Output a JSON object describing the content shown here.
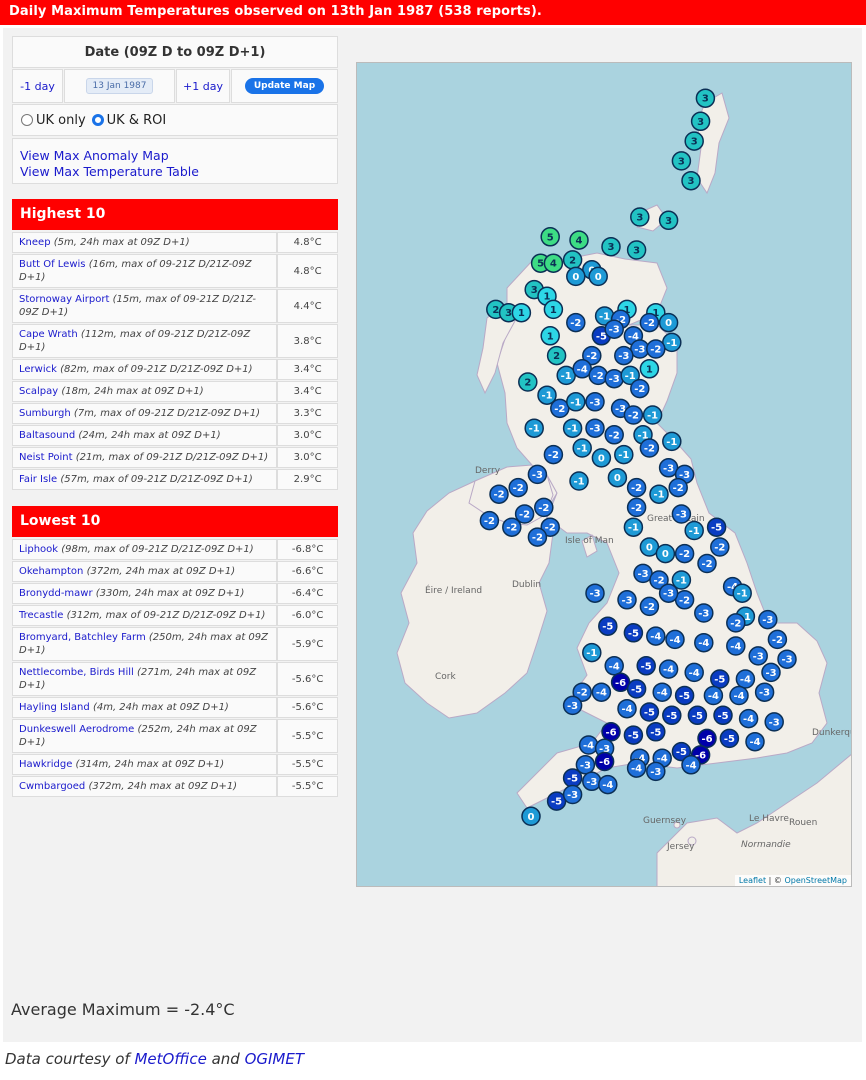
{
  "banner": "Daily Maximum Temperatures observed on 13th Jan 1987 (538 reports).",
  "date_panel": {
    "heading": "Date (09Z D to 09Z D+1)",
    "prev_label": "-1 day",
    "date_value": "13 Jan 1987",
    "next_label": "+1 day",
    "update_label": "Update Map"
  },
  "region": {
    "uk_label": "UK only",
    "ukroi_label": "UK & ROI",
    "selected": "UK & ROI"
  },
  "links": {
    "anomaly": "View Max Anomaly Map",
    "table": "View Max Temperature Table"
  },
  "highest": {
    "title": "Highest 10",
    "rows": [
      {
        "name": "Kneep",
        "desc": "(5m, 24h max at 09Z D+1)",
        "value": "4.8°C"
      },
      {
        "name": "Butt Of Lewis",
        "desc": "(16m, max of 09-21Z D/21Z-09Z D+1)",
        "value": "4.8°C"
      },
      {
        "name": "Stornoway Airport",
        "desc": "(15m, max of 09-21Z D/21Z-09Z D+1)",
        "value": "4.4°C"
      },
      {
        "name": "Cape Wrath",
        "desc": "(112m, max of 09-21Z D/21Z-09Z D+1)",
        "value": "3.8°C"
      },
      {
        "name": "Lerwick",
        "desc": "(82m, max of 09-21Z D/21Z-09Z D+1)",
        "value": "3.4°C"
      },
      {
        "name": "Scalpay",
        "desc": "(18m, 24h max at 09Z D+1)",
        "value": "3.4°C"
      },
      {
        "name": "Sumburgh",
        "desc": "(7m, max of 09-21Z D/21Z-09Z D+1)",
        "value": "3.3°C"
      },
      {
        "name": "Baltasound",
        "desc": "(24m, 24h max at 09Z D+1)",
        "value": "3.0°C"
      },
      {
        "name": "Neist Point",
        "desc": "(21m, max of 09-21Z D/21Z-09Z D+1)",
        "value": "3.0°C"
      },
      {
        "name": "Fair Isle",
        "desc": "(57m, max of 09-21Z D/21Z-09Z D+1)",
        "value": "2.9°C"
      }
    ]
  },
  "lowest": {
    "title": "Lowest 10",
    "rows": [
      {
        "name": "Liphook",
        "desc": "(98m, max of 09-21Z D/21Z-09Z D+1)",
        "value": "-6.8°C"
      },
      {
        "name": "Okehampton",
        "desc": "(372m, 24h max at 09Z D+1)",
        "value": "-6.6°C"
      },
      {
        "name": "Bronydd-mawr",
        "desc": "(330m, 24h max at 09Z D+1)",
        "value": "-6.4°C"
      },
      {
        "name": "Trecastle",
        "desc": "(312m, max of 09-21Z D/21Z-09Z D+1)",
        "value": "-6.0°C"
      },
      {
        "name": "Bromyard, Batchley Farm",
        "desc": "(250m, 24h max at 09Z D+1)",
        "value": "-5.9°C"
      },
      {
        "name": "Nettlecombe, Birds Hill",
        "desc": "(271m, 24h max at 09Z D+1)",
        "value": "-5.6°C"
      },
      {
        "name": "Hayling Island",
        "desc": "(4m, 24h max at 09Z D+1)",
        "value": "-5.6°C"
      },
      {
        "name": "Dunkeswell Aerodrome",
        "desc": "(252m, 24h max at 09Z D+1)",
        "value": "-5.5°C"
      },
      {
        "name": "Hawkridge",
        "desc": "(314m, 24h max at 09Z D+1)",
        "value": "-5.5°C"
      },
      {
        "name": "Cwmbargoed",
        "desc": "(372m, 24h max at 09Z D+1)",
        "value": "-5.5°C"
      }
    ]
  },
  "average": "Average Maximum = -2.4°C",
  "map": {
    "labels": {
      "ireland": "Éire / Ireland",
      "dublin": "Dublin",
      "cork": "Cork",
      "isle_of_man": "Isle of Man",
      "great_britain": "Great Britain",
      "guernsey": "Guernsey",
      "jersey": "Jersey",
      "le_havre": "Le Havre",
      "rouen": "Rouen",
      "normandie": "Normandie",
      "derry": "Derry",
      "dunkerque": "Dunkerque"
    },
    "attribution": {
      "leaflet": "Leaflet",
      "sep": " | © ",
      "osm": "OpenStreetMap"
    },
    "colors": {
      "warm4": "#3ddc84",
      "warm3": "#22c3c3",
      "mild1": "#2dd6e6",
      "zero": "#1e9ad6",
      "cold2": "#1f6fd9",
      "cold5": "#0a3cc2",
      "cold6": "#0000aa"
    },
    "markers": [
      {
        "v": 3,
        "lon": -0.85,
        "lat": 60.8
      },
      {
        "v": 3,
        "lon": -1.0,
        "lat": 60.45
      },
      {
        "v": 3,
        "lon": -1.2,
        "lat": 60.15
      },
      {
        "v": 3,
        "lon": -1.6,
        "lat": 59.85
      },
      {
        "v": 3,
        "lon": -1.3,
        "lat": 59.55
      },
      {
        "v": 3,
        "lon": -2.9,
        "lat": 59.0
      },
      {
        "v": 3,
        "lon": -2.0,
        "lat": 58.95
      },
      {
        "v": 5,
        "lon": -5.7,
        "lat": 58.7
      },
      {
        "v": 4,
        "lon": -4.8,
        "lat": 58.65
      },
      {
        "v": 3,
        "lon": -3.8,
        "lat": 58.55
      },
      {
        "v": 3,
        "lon": -3.0,
        "lat": 58.5
      },
      {
        "v": 5,
        "lon": -6.0,
        "lat": 58.3
      },
      {
        "v": 4,
        "lon": -5.6,
        "lat": 58.3
      },
      {
        "v": 2,
        "lon": -5.0,
        "lat": 58.35
      },
      {
        "v": 0,
        "lon": -4.4,
        "lat": 58.2
      },
      {
        "v": 0,
        "lon": -4.9,
        "lat": 58.1
      },
      {
        "v": 0,
        "lon": -4.2,
        "lat": 58.1
      },
      {
        "v": 3,
        "lon": -6.2,
        "lat": 57.9
      },
      {
        "v": 2,
        "lon": -7.4,
        "lat": 57.6
      },
      {
        "v": 3,
        "lon": -7.0,
        "lat": 57.55
      },
      {
        "v": 1,
        "lon": -6.6,
        "lat": 57.55
      },
      {
        "v": 1,
        "lon": -5.8,
        "lat": 57.8
      },
      {
        "v": 1,
        "lon": -5.6,
        "lat": 57.6
      },
      {
        "v": 1,
        "lon": -5.7,
        "lat": 57.2
      },
      {
        "v": 2,
        "lon": -5.5,
        "lat": 56.9
      },
      {
        "v": 2,
        "lon": -6.4,
        "lat": 56.5
      },
      {
        "v": 1,
        "lon": -3.3,
        "lat": 57.6
      },
      {
        "v": 1,
        "lon": -2.4,
        "lat": 57.55
      },
      {
        "v": 0,
        "lon": -2.0,
        "lat": 57.4
      },
      {
        "v": -2,
        "lon": -2.6,
        "lat": 57.4
      },
      {
        "v": -1,
        "lon": -1.9,
        "lat": 57.1
      },
      {
        "v": -2,
        "lon": -4.9,
        "lat": 57.4
      },
      {
        "v": -1,
        "lon": -4.0,
        "lat": 57.5
      },
      {
        "v": -2,
        "lon": -3.5,
        "lat": 57.45
      },
      {
        "v": -5,
        "lon": -4.1,
        "lat": 57.2
      },
      {
        "v": -3,
        "lon": -3.7,
        "lat": 57.3
      },
      {
        "v": -4,
        "lon": -3.1,
        "lat": 57.2
      },
      {
        "v": -3,
        "lon": -2.9,
        "lat": 57.0
      },
      {
        "v": -2,
        "lon": -2.4,
        "lat": 57.0
      },
      {
        "v": -3,
        "lon": -3.4,
        "lat": 56.9
      },
      {
        "v": -2,
        "lon": -4.4,
        "lat": 56.9
      },
      {
        "v": -1,
        "lon": -5.2,
        "lat": 56.6
      },
      {
        "v": -1,
        "lon": -5.8,
        "lat": 56.3
      },
      {
        "v": -4,
        "lon": -4.7,
        "lat": 56.7
      },
      {
        "v": -2,
        "lon": -4.2,
        "lat": 56.6
      },
      {
        "v": -3,
        "lon": -3.7,
        "lat": 56.55
      },
      {
        "v": -1,
        "lon": -3.2,
        "lat": 56.6
      },
      {
        "v": 1,
        "lon": -2.6,
        "lat": 56.7
      },
      {
        "v": -2,
        "lon": -2.9,
        "lat": 56.4
      },
      {
        "v": -2,
        "lon": -5.4,
        "lat": 56.1
      },
      {
        "v": -1,
        "lon": -4.9,
        "lat": 56.2
      },
      {
        "v": -3,
        "lon": -4.3,
        "lat": 56.2
      },
      {
        "v": -3,
        "lon": -3.5,
        "lat": 56.1
      },
      {
        "v": -2,
        "lon": -3.1,
        "lat": 56.0
      },
      {
        "v": -1,
        "lon": -2.5,
        "lat": 56.0
      },
      {
        "v": -1,
        "lon": -6.2,
        "lat": 55.8
      },
      {
        "v": -1,
        "lon": -5.0,
        "lat": 55.8
      },
      {
        "v": -3,
        "lon": -4.3,
        "lat": 55.8
      },
      {
        "v": -2,
        "lon": -3.7,
        "lat": 55.7
      },
      {
        "v": -1,
        "lon": -2.8,
        "lat": 55.7
      },
      {
        "v": -2,
        "lon": -5.6,
        "lat": 55.4
      },
      {
        "v": -1,
        "lon": -4.7,
        "lat": 55.5
      },
      {
        "v": 0,
        "lon": -4.1,
        "lat": 55.35
      },
      {
        "v": -1,
        "lon": -3.4,
        "lat": 55.4
      },
      {
        "v": -2,
        "lon": -2.6,
        "lat": 55.5
      },
      {
        "v": -1,
        "lon": -1.9,
        "lat": 55.6
      },
      {
        "v": -3,
        "lon": -2.0,
        "lat": 55.2
      },
      {
        "v": -3,
        "lon": -1.5,
        "lat": 55.1
      },
      {
        "v": -2,
        "lon": -1.7,
        "lat": 54.9
      },
      {
        "v": -1,
        "lon": -4.8,
        "lat": 55.0
      },
      {
        "v": 0,
        "lon": -3.6,
        "lat": 55.05
      },
      {
        "v": -2,
        "lon": -3.0,
        "lat": 54.9
      },
      {
        "v": -1,
        "lon": -2.3,
        "lat": 54.8
      },
      {
        "v": -3,
        "lon": -6.1,
        "lat": 55.1
      },
      {
        "v": -2,
        "lon": -6.7,
        "lat": 54.9
      },
      {
        "v": -2,
        "lon": -7.3,
        "lat": 54.8
      },
      {
        "v": -2,
        "lon": -5.9,
        "lat": 54.6
      },
      {
        "v": -2,
        "lon": -6.5,
        "lat": 54.5
      },
      {
        "v": -2,
        "lon": -7.6,
        "lat": 54.4
      },
      {
        "v": -2,
        "lon": -5.7,
        "lat": 54.3
      },
      {
        "v": -2,
        "lon": -6.9,
        "lat": 54.3
      },
      {
        "v": -2,
        "lon": -6.1,
        "lat": 54.15
      },
      {
        "v": -2,
        "lon": -3.0,
        "lat": 54.6
      },
      {
        "v": -1,
        "lon": -3.1,
        "lat": 54.3
      },
      {
        "v": -3,
        "lon": -1.6,
        "lat": 54.5
      },
      {
        "v": -1,
        "lon": -1.2,
        "lat": 54.25
      },
      {
        "v": -5,
        "lon": -0.5,
        "lat": 54.3
      },
      {
        "v": -2,
        "lon": -0.4,
        "lat": 54.0
      },
      {
        "v": 0,
        "lon": -2.6,
        "lat": 54.0
      },
      {
        "v": 0,
        "lon": -2.1,
        "lat": 53.9
      },
      {
        "v": -2,
        "lon": -1.5,
        "lat": 53.9
      },
      {
        "v": -2,
        "lon": -0.8,
        "lat": 53.75
      },
      {
        "v": -3,
        "lon": -2.8,
        "lat": 53.6
      },
      {
        "v": -2,
        "lon": -2.3,
        "lat": 53.5
      },
      {
        "v": -1,
        "lon": -1.6,
        "lat": 53.5
      },
      {
        "v": -4,
        "lon": 0.0,
        "lat": 53.4
      },
      {
        "v": -1,
        "lon": 0.3,
        "lat": 53.3
      },
      {
        "v": -3,
        "lon": -4.3,
        "lat": 53.3
      },
      {
        "v": -3,
        "lon": -3.3,
        "lat": 53.2
      },
      {
        "v": -2,
        "lon": -2.6,
        "lat": 53.1
      },
      {
        "v": -2,
        "lon": -1.5,
        "lat": 53.2
      },
      {
        "v": -3,
        "lon": -0.9,
        "lat": 53.0
      },
      {
        "v": -1,
        "lon": 0.4,
        "lat": 52.95
      },
      {
        "v": -3,
        "lon": 1.1,
        "lat": 52.9
      },
      {
        "v": -2,
        "lon": 1.4,
        "lat": 52.6
      },
      {
        "v": -5,
        "lon": -3.9,
        "lat": 52.8
      },
      {
        "v": -5,
        "lon": -3.1,
        "lat": 52.7
      },
      {
        "v": -4,
        "lon": -2.4,
        "lat": 52.65
      },
      {
        "v": -4,
        "lon": -1.8,
        "lat": 52.6
      },
      {
        "v": -4,
        "lon": -0.9,
        "lat": 52.55
      },
      {
        "v": -4,
        "lon": 0.1,
        "lat": 52.5
      },
      {
        "v": -3,
        "lon": 0.8,
        "lat": 52.35
      },
      {
        "v": -1,
        "lon": -4.4,
        "lat": 52.4
      },
      {
        "v": -4,
        "lon": -3.7,
        "lat": 52.2
      },
      {
        "v": -5,
        "lon": -2.7,
        "lat": 52.2
      },
      {
        "v": -4,
        "lon": -2.0,
        "lat": 52.15
      },
      {
        "v": -4,
        "lon": -1.2,
        "lat": 52.1
      },
      {
        "v": -5,
        "lon": -0.4,
        "lat": 52.0
      },
      {
        "v": -4,
        "lon": 0.4,
        "lat": 52.0
      },
      {
        "v": -3,
        "lon": 1.2,
        "lat": 52.1
      },
      {
        "v": -3,
        "lon": 1.7,
        "lat": 52.3
      },
      {
        "v": -6,
        "lon": -3.5,
        "lat": 51.95
      },
      {
        "v": -5,
        "lon": -3.0,
        "lat": 51.85
      },
      {
        "v": -2,
        "lon": -4.7,
        "lat": 51.8
      },
      {
        "v": -4,
        "lon": -4.1,
        "lat": 51.8
      },
      {
        "v": -4,
        "lon": -2.2,
        "lat": 51.8
      },
      {
        "v": -5,
        "lon": -1.5,
        "lat": 51.75
      },
      {
        "v": -4,
        "lon": -0.6,
        "lat": 51.75
      },
      {
        "v": -4,
        "lon": 0.2,
        "lat": 51.75
      },
      {
        "v": -3,
        "lon": 1.0,
        "lat": 51.8
      },
      {
        "v": -3,
        "lon": -5.0,
        "lat": 51.6
      },
      {
        "v": -4,
        "lon": -3.3,
        "lat": 51.55
      },
      {
        "v": -5,
        "lon": -2.6,
        "lat": 51.5
      },
      {
        "v": -5,
        "lon": -1.9,
        "lat": 51.45
      },
      {
        "v": -5,
        "lon": -1.1,
        "lat": 51.45
      },
      {
        "v": -5,
        "lon": -0.3,
        "lat": 51.45
      },
      {
        "v": -4,
        "lon": 0.5,
        "lat": 51.4
      },
      {
        "v": -3,
        "lon": 1.3,
        "lat": 51.35
      },
      {
        "v": -6,
        "lon": -3.8,
        "lat": 51.2
      },
      {
        "v": -5,
        "lon": -3.1,
        "lat": 51.15
      },
      {
        "v": -5,
        "lon": -2.4,
        "lat": 51.2
      },
      {
        "v": -6,
        "lon": -0.8,
        "lat": 51.1
      },
      {
        "v": -5,
        "lon": -0.1,
        "lat": 51.1
      },
      {
        "v": -4,
        "lon": 0.7,
        "lat": 51.05
      },
      {
        "v": -4,
        "lon": -4.5,
        "lat": 51.0
      },
      {
        "v": -3,
        "lon": -4.0,
        "lat": 50.95
      },
      {
        "v": -6,
        "lon": -1.0,
        "lat": 50.85
      },
      {
        "v": -5,
        "lon": -1.6,
        "lat": 50.9
      },
      {
        "v": -4,
        "lon": -2.2,
        "lat": 50.8
      },
      {
        "v": -4,
        "lon": -2.9,
        "lat": 50.8
      },
      {
        "v": -6,
        "lon": -4.0,
        "lat": 50.75
      },
      {
        "v": -3,
        "lon": -4.6,
        "lat": 50.7
      },
      {
        "v": -5,
        "lon": -5.0,
        "lat": 50.5
      },
      {
        "v": -3,
        "lon": -4.4,
        "lat": 50.45
      },
      {
        "v": -4,
        "lon": -3.9,
        "lat": 50.4
      },
      {
        "v": -4,
        "lon": -3.0,
        "lat": 50.65
      },
      {
        "v": -3,
        "lon": -2.4,
        "lat": 50.6
      },
      {
        "v": -4,
        "lon": -1.3,
        "lat": 50.7
      },
      {
        "v": -5,
        "lon": -5.5,
        "lat": 50.15
      },
      {
        "v": -3,
        "lon": -5.0,
        "lat": 50.25
      },
      {
        "v": 0,
        "lon": -6.3,
        "lat": 49.92
      },
      {
        "v": -2,
        "lon": 0.1,
        "lat": 52.85
      },
      {
        "v": -3,
        "lon": -2.0,
        "lat": 53.3
      }
    ]
  },
  "footer": {
    "prefix": "Data courtesy of ",
    "link1": "MetOffice",
    "and": " and ",
    "link2": "OGIMET"
  }
}
